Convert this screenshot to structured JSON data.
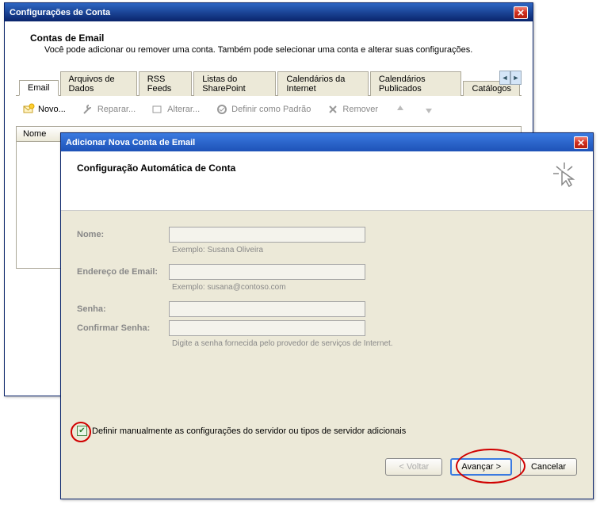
{
  "window1": {
    "title": "Configurações de Conta",
    "section_title": "Contas de Email",
    "section_desc": "Você pode adicionar ou remover uma conta. Também pode selecionar uma conta e alterar suas configurações.",
    "tabs": [
      {
        "label": "Email",
        "active": true
      },
      {
        "label": "Arquivos de Dados"
      },
      {
        "label": "RSS Feeds"
      },
      {
        "label": "Listas do SharePoint"
      },
      {
        "label": "Calendários da Internet"
      },
      {
        "label": "Calendários Publicados"
      },
      {
        "label": "Catálogos"
      }
    ],
    "toolbar": {
      "new": "Novo...",
      "repair": "Reparar...",
      "change": "Alterar...",
      "default": "Definir como Padrão",
      "remove": "Remover"
    },
    "list_header": "Nome"
  },
  "window2": {
    "title": "Adicionar Nova Conta de Email",
    "header_title": "Configuração Automática de Conta",
    "form": {
      "name_label": "Nome:",
      "name_hint": "Exemplo: Susana Oliveira",
      "email_label": "Endereço de Email:",
      "email_hint": "Exemplo: susana@contoso.com",
      "password_label": "Senha:",
      "confirm_label": "Confirmar Senha:",
      "password_hint": "Digite a senha fornecida pelo provedor de serviços de Internet."
    },
    "checkbox_label": "Definir manualmente as configurações do servidor ou tipos de servidor adicionais",
    "buttons": {
      "back": "< Voltar",
      "next": "Avançar >",
      "cancel": "Cancelar"
    }
  }
}
